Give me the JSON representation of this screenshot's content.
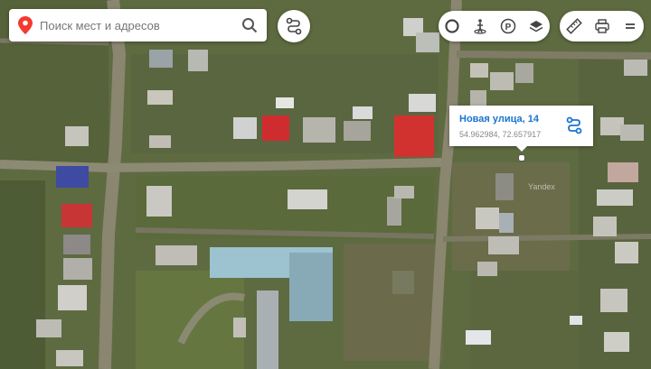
{
  "search": {
    "placeholder": "Поиск мест и адресов"
  },
  "toolbar": {
    "left_pill": [
      "panorama-icon",
      "transit-icon",
      "parking-icon",
      "layers-icon"
    ],
    "right_pill": [
      "ruler-icon",
      "print-icon",
      "menu-icon"
    ]
  },
  "place_card": {
    "title": "Новая улица, 14",
    "coordinates": "54.962984, 72.657917"
  },
  "watermark": "Yandex",
  "colors": {
    "accent": "#1a73cf",
    "pin": "#f33a30"
  }
}
